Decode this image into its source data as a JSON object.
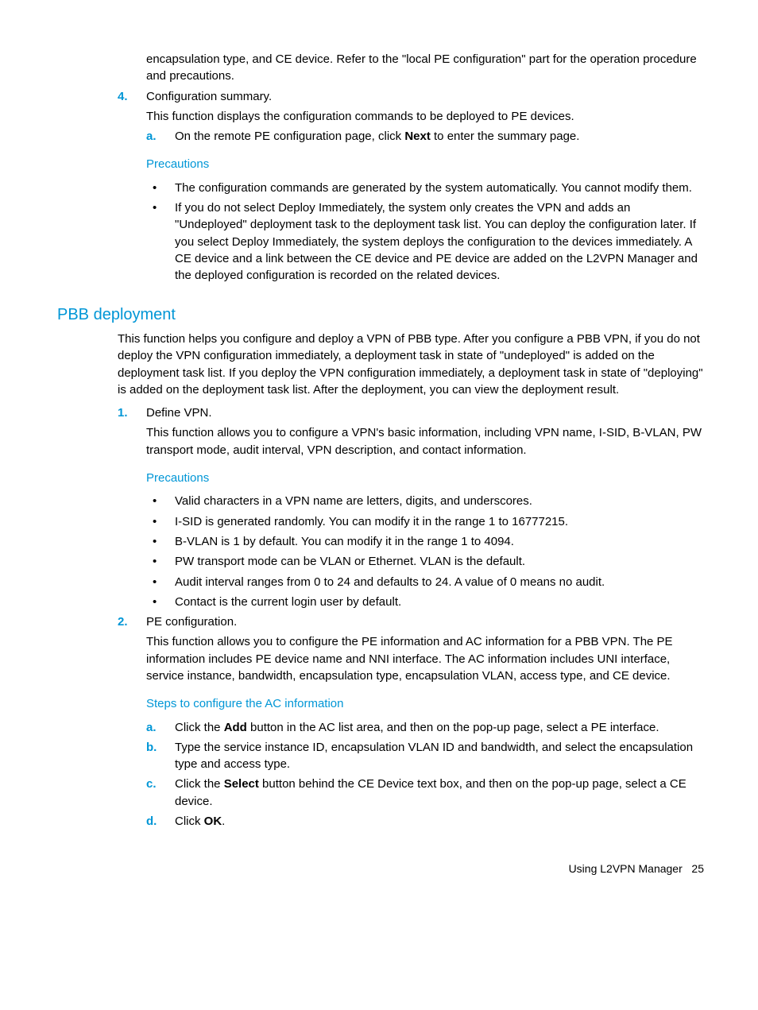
{
  "para_top": "encapsulation type, and CE device. Refer to the \"local PE configuration\" part for the operation procedure and precautions.",
  "step4": {
    "marker": "4.",
    "title": "Configuration summary.",
    "desc": "This function displays the configuration commands to be deployed to PE devices.",
    "a_marker": "a.",
    "a_text_pre": "On the remote PE configuration page, click ",
    "a_bold": "Next",
    "a_text_post": " to enter the summary page.",
    "prec_heading": "Precautions",
    "prec1": "The configuration commands are generated by the system automatically. You cannot modify them.",
    "prec2": "If you do not select Deploy Immediately, the system only creates the VPN and adds an \"Undeployed\" deployment task to the deployment task list. You can deploy the configuration later. If you select Deploy Immediately, the system deploys the configuration to the devices immediately. A CE device and a link between the CE device and PE device are added on the L2VPN Manager and the deployed configuration is recorded on the related devices."
  },
  "pbb": {
    "heading": "PBB deployment",
    "intro": "This function helps you configure and deploy a VPN of PBB type. After you configure a PBB VPN, if you do not deploy the VPN configuration immediately, a deployment task in state of \"undeployed\" is added on the deployment task list. If you deploy the VPN configuration immediately, a deployment task in state of \"deploying\" is added on the deployment task list. After the deployment, you can view the deployment result.",
    "s1": {
      "marker": "1.",
      "title": "Define VPN.",
      "desc": "This function allows you to configure a VPN's basic information, including VPN name, I-SID, B-VLAN, PW transport mode, audit interval, VPN description, and contact information.",
      "prec_heading": "Precautions",
      "b1": "Valid characters in a VPN name are letters, digits, and underscores.",
      "b2": "I-SID is generated randomly. You can modify it in the range 1 to 16777215.",
      "b3": "B-VLAN is 1 by default. You can modify it in the range 1 to 4094.",
      "b4": "PW transport mode can be VLAN or Ethernet. VLAN is the default.",
      "b5": "Audit interval ranges from 0 to 24 and defaults to 24. A value of 0 means no audit.",
      "b6": "Contact is the current login user by default."
    },
    "s2": {
      "marker": "2.",
      "title": "PE configuration.",
      "desc": "This function allows you to configure the PE information and AC information for a PBB VPN. The PE information includes PE device name and NNI interface. The AC information includes UNI interface, service instance, bandwidth, encapsulation type, encapsulation VLAN, access type, and CE device.",
      "steps_heading": "Steps to configure the AC information",
      "a": {
        "m": "a.",
        "pre": "Click the ",
        "b": "Add",
        "post": " button in the AC list area, and then on the pop-up page, select a PE interface."
      },
      "b": {
        "m": "b.",
        "text": "Type the service instance ID, encapsulation VLAN ID and bandwidth, and select the encapsulation type and access type."
      },
      "c": {
        "m": "c.",
        "pre": "Click the ",
        "b": "Select",
        "post": " button behind the CE Device text box, and then on the pop-up page, select a CE device."
      },
      "d": {
        "m": "d.",
        "pre": "Click ",
        "b": "OK",
        "post": "."
      }
    }
  },
  "footer": {
    "label": "Using L2VPN Manager",
    "page": "25"
  }
}
